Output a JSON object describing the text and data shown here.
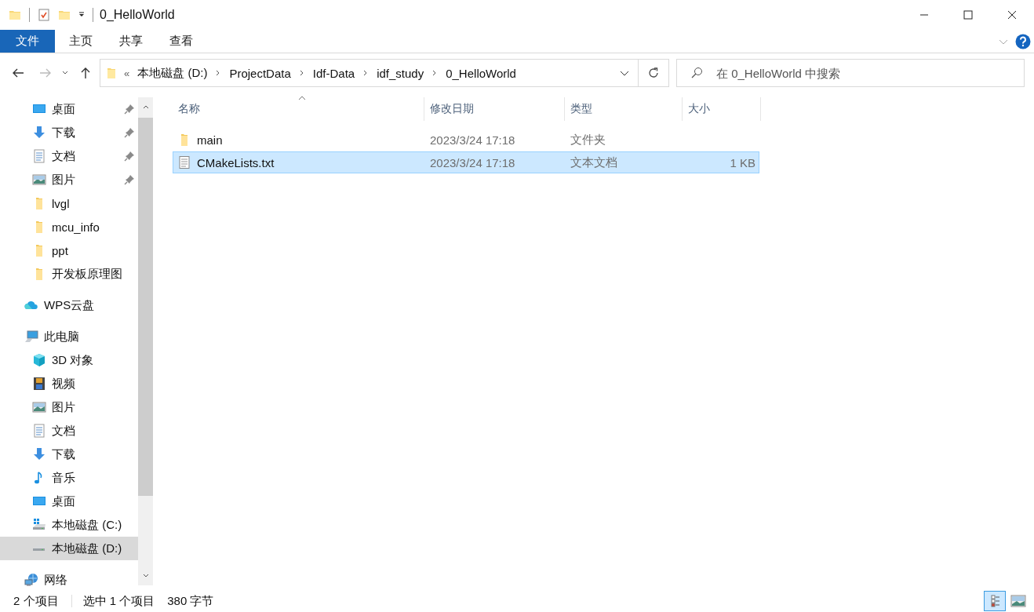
{
  "window": {
    "title": "0_HelloWorld"
  },
  "ribbon_tabs": [
    {
      "label": "文件",
      "kind": "file",
      "selected": false
    },
    {
      "label": "主页",
      "kind": "tab",
      "selected": false
    },
    {
      "label": "共享",
      "kind": "tab",
      "selected": false
    },
    {
      "label": "查看",
      "kind": "tab",
      "selected": false
    }
  ],
  "address_bar": {
    "overflow": "«",
    "crumbs": [
      "本地磁盘 (D:)",
      "ProjectData",
      "Idf-Data",
      "idf_study",
      "0_HelloWorld"
    ]
  },
  "search": {
    "placeholder": "在 0_HelloWorld 中搜索"
  },
  "sidebar": {
    "quick_access": [
      {
        "label": "桌面",
        "kind": "desktop",
        "pinned": true,
        "selected": false
      },
      {
        "label": "下载",
        "kind": "download",
        "pinned": true,
        "selected": false
      },
      {
        "label": "文档",
        "kind": "document",
        "pinned": true,
        "selected": false
      },
      {
        "label": "图片",
        "kind": "pictures",
        "pinned": true,
        "selected": false
      },
      {
        "label": "lvgl",
        "kind": "folder",
        "pinned": false,
        "selected": false
      },
      {
        "label": "mcu_info",
        "kind": "folder",
        "pinned": false,
        "selected": false
      },
      {
        "label": "ppt",
        "kind": "folder",
        "pinned": false,
        "selected": false
      },
      {
        "label": "开发板原理图",
        "kind": "folder",
        "pinned": false,
        "selected": false
      }
    ],
    "items": [
      {
        "label": "WPS云盘",
        "kind": "cloud",
        "selected": false
      },
      {
        "label": "此电脑",
        "kind": "pc",
        "selected": false,
        "children": [
          {
            "label": "3D 对象",
            "kind": "cube",
            "selected": false
          },
          {
            "label": "视频",
            "kind": "video",
            "selected": false
          },
          {
            "label": "图片",
            "kind": "pictures",
            "selected": false
          },
          {
            "label": "文档",
            "kind": "document",
            "selected": false
          },
          {
            "label": "下载",
            "kind": "download",
            "selected": false
          },
          {
            "label": "音乐",
            "kind": "music",
            "selected": false
          },
          {
            "label": "桌面",
            "kind": "desktop",
            "selected": false
          },
          {
            "label": "本地磁盘 (C:)",
            "kind": "drive-c",
            "selected": false
          },
          {
            "label": "本地磁盘 (D:)",
            "kind": "drive",
            "selected": true
          }
        ]
      },
      {
        "label": "网络",
        "kind": "network",
        "selected": false
      }
    ]
  },
  "table": {
    "columns": [
      {
        "label": "名称",
        "sorted": true
      },
      {
        "label": "修改日期",
        "sorted": false
      },
      {
        "label": "类型",
        "sorted": false
      },
      {
        "label": "大小",
        "sorted": false
      }
    ],
    "rows": [
      {
        "name": "main",
        "modified": "2023/3/24 17:18",
        "type": "文件夹",
        "size": "",
        "kind": "folder",
        "selected": false
      },
      {
        "name": "CMakeLists.txt",
        "modified": "2023/3/24 17:18",
        "type": "文本文档",
        "size": "1 KB",
        "kind": "text",
        "selected": true
      }
    ]
  },
  "status_bar": {
    "count": "2 个项目",
    "selection": "选中 1 个项目",
    "size": "380 字节",
    "views": [
      {
        "kind": "details",
        "selected": true
      },
      {
        "kind": "large-icons",
        "selected": false
      }
    ]
  }
}
